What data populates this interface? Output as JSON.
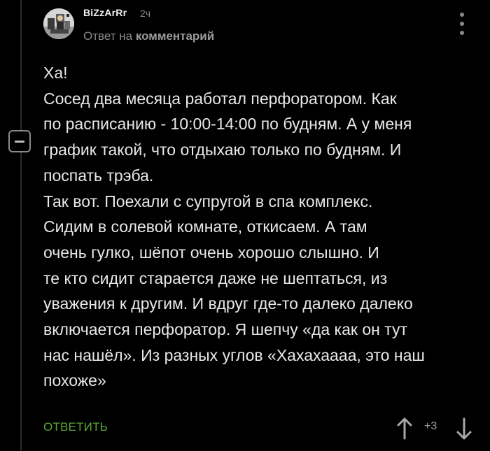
{
  "comment": {
    "author": "BiZzArRr",
    "time": "2ч",
    "reply_to_prefix": "Ответ на",
    "reply_to_link": "комментарий",
    "body_lines": [
      "Ха!",
      "Сосед два месяца работал перфоратором. Как",
      "по расписанию - 10:00-14:00 по будням. А у меня",
      "график такой, что отдыхаю только по будням. И",
      "поспать трэба.",
      "Так вот. Поехали с супругой в спа комплекс.",
      "Сидим в солевой комнате, откисаем. А там",
      "очень гулко, шёпот очень хорошо слышно. И",
      "те кто сидит старается даже не шептаться, из",
      "уважения к другим. И вдруг где-то далеко далеко",
      "включается перфоратор. Я шепчу «да как он тут",
      "нас нашёл». Из разных углов «Хахахаааа, это наш",
      "похоже»"
    ],
    "reply_label": "ОТВЕТИТЬ",
    "rating": "+3"
  },
  "icons": {
    "collapse": "minus-square-icon",
    "more": "vertical-dots-icon",
    "vote_up": "arrow-up-icon",
    "vote_down": "arrow-down-icon"
  },
  "colors": {
    "background": "#000000",
    "text": "#e8e8e8",
    "muted": "#8a8a8a",
    "reply_green": "#5ba83a"
  }
}
